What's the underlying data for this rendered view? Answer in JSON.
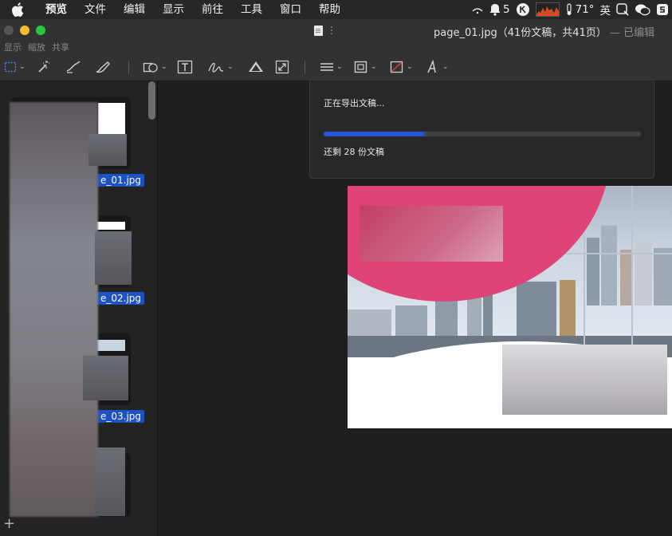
{
  "menubar": {
    "app_menus": [
      "预览",
      "文件",
      "编辑",
      "显示",
      "前往",
      "工具",
      "窗口",
      "帮助"
    ],
    "status": {
      "notifications": "5",
      "temperature": "71°",
      "input_method": "英"
    }
  },
  "window": {
    "sub_labels": [
      "显示",
      "缩放",
      "共享"
    ],
    "title": "page_01.jpg（41份文稿，共41页）",
    "edited": "— 已编辑"
  },
  "toolbar": {
    "tools": [
      "selection-icon",
      "magic-wand-icon",
      "sketch-icon",
      "draw-icon",
      "shapes-icon",
      "text-icon",
      "sign-icon",
      "adjust-color-icon",
      "adjust-size-icon",
      "shape-style-icon",
      "border-color-icon",
      "fill-color-icon",
      "text-style-icon"
    ]
  },
  "sidebar": {
    "thumbnails": [
      {
        "label": "e_01.jpg"
      },
      {
        "label": "e_02.jpg"
      },
      {
        "label": "e_03.jpg"
      },
      {
        "label": ""
      }
    ],
    "add_label": "+"
  },
  "export_sheet": {
    "title": "正在导出文稿...",
    "progress": 0.32,
    "remaining": "还剩 28 份文稿"
  },
  "colors": {
    "accent": "#2458d6",
    "brand_pink": "#e04377",
    "selection": "#1d52c3"
  }
}
